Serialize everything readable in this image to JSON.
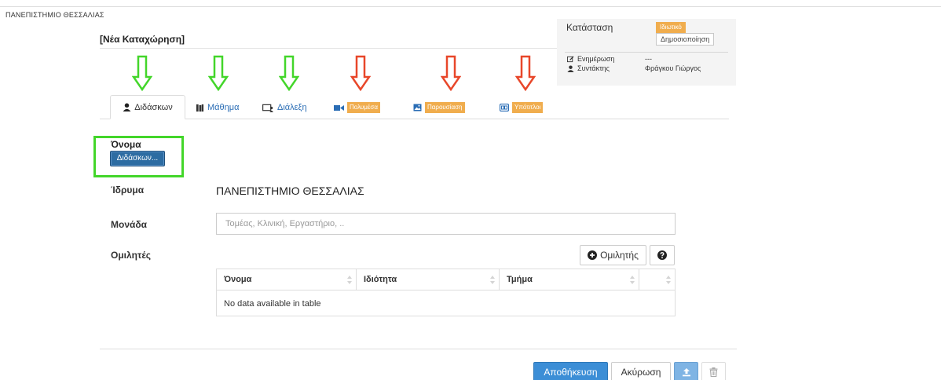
{
  "header": {
    "institution_label": "ΠΑΝΕΠΙΣΤΗΜΙΟ ΘΕΣΣΑΛΙΑΣ",
    "form_title": "[Νέα Καταχώρηση]"
  },
  "status_panel": {
    "status_label": "Κατάσταση",
    "status_value": "Ιδιωτικό",
    "publish_button": "Δημοσιοποίηση",
    "updated_label": "Ενημέρωση",
    "updated_value": "---",
    "author_label": "Συντάκτης",
    "author_value": "Φράγκου Γιώργος"
  },
  "colors": {
    "accent_blue": "#2a6db5",
    "warning_orange": "#f0ad4e",
    "arrow_green": "#43d62a",
    "arrow_red": "#e8472a"
  },
  "tabs": [
    {
      "label": "Διδάσκων",
      "icon": "user-icon",
      "active": true
    },
    {
      "label": "Μάθημα",
      "icon": "book-icon",
      "active": false
    },
    {
      "label": "Διάλεξη",
      "icon": "lecture-icon",
      "active": false
    },
    {
      "label": "Πολυμέσα",
      "icon": "video-icon",
      "active": false
    },
    {
      "label": "Παρουσίαση",
      "icon": "image-icon",
      "active": false
    },
    {
      "label": "Υπότιτλοι",
      "icon": "subtitles-icon",
      "active": false
    }
  ],
  "form": {
    "name_label": "Όνομα",
    "instructor_button": "Διδάσκων...",
    "institution_label": "Ίδρυμα",
    "institution_value": "ΠΑΝΕΠΙΣΤΗΜΙΟ ΘΕΣΣΑΛΙΑΣ",
    "unit_label": "Μονάδα",
    "unit_placeholder": "Τομέας, Κλινική, Εργαστήριο, ..",
    "speakers_label": "Ομιλητές",
    "add_speaker_button": "Ομιλητής"
  },
  "speakers_table": {
    "columns": [
      "Όνομα",
      "Ιδιότητα",
      "Τμήμα",
      ""
    ],
    "empty_message": "No data available in table"
  },
  "footer": {
    "save_button": "Αποθήκευση",
    "cancel_button": "Ακύρωση"
  }
}
